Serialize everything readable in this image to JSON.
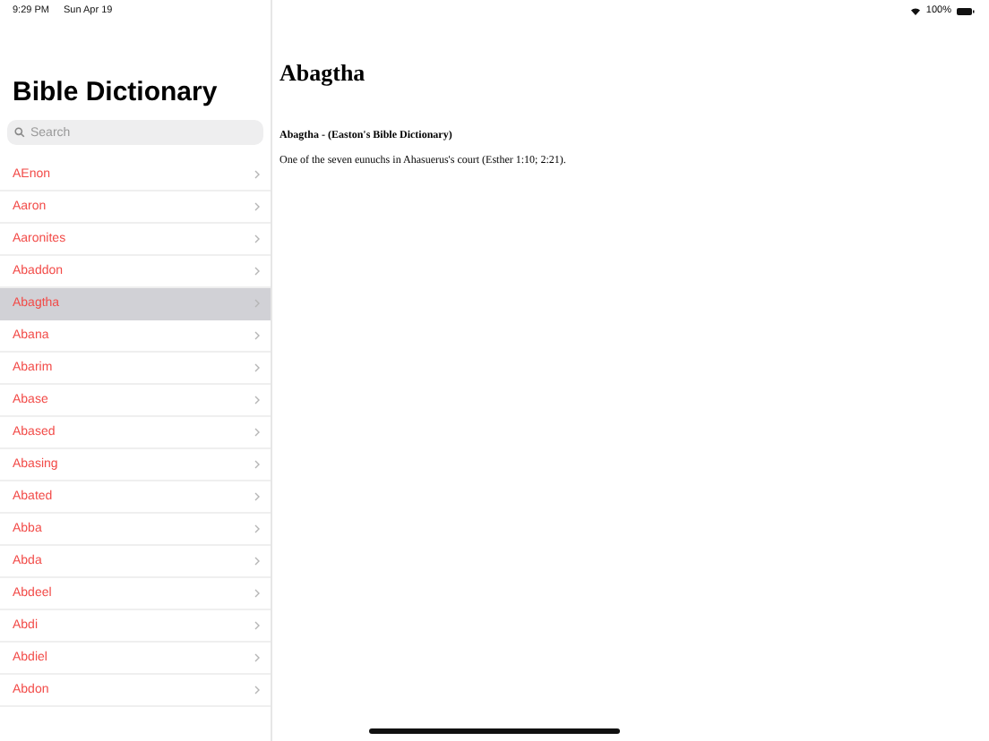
{
  "status_bar": {
    "time": "9:29 PM",
    "date": "Sun Apr 19",
    "battery": "100%"
  },
  "sidebar": {
    "title": "Bible Dictionary",
    "search": {
      "placeholder": "Search"
    },
    "items": [
      {
        "label": "AEnon",
        "selected": false
      },
      {
        "label": "Aaron",
        "selected": false
      },
      {
        "label": "Aaronites",
        "selected": false
      },
      {
        "label": "Abaddon",
        "selected": false
      },
      {
        "label": "Abagtha",
        "selected": true
      },
      {
        "label": "Abana",
        "selected": false
      },
      {
        "label": "Abarim",
        "selected": false
      },
      {
        "label": "Abase",
        "selected": false
      },
      {
        "label": "Abased",
        "selected": false
      },
      {
        "label": "Abasing",
        "selected": false
      },
      {
        "label": "Abated",
        "selected": false
      },
      {
        "label": "Abba",
        "selected": false
      },
      {
        "label": "Abda",
        "selected": false
      },
      {
        "label": "Abdeel",
        "selected": false
      },
      {
        "label": "Abdi",
        "selected": false
      },
      {
        "label": "Abdiel",
        "selected": false
      },
      {
        "label": "Abdon",
        "selected": false
      }
    ]
  },
  "detail": {
    "title": "Abagtha",
    "source": "Abagtha - (Easton's Bible Dictionary)",
    "body": "One of the seven eunuchs in Ahasuerus's court (Esther 1:10; 2:21)."
  }
}
